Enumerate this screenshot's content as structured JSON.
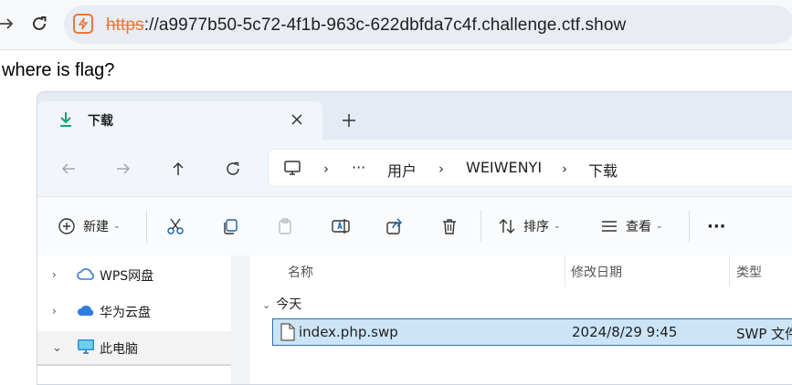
{
  "browser": {
    "url_scheme": "https",
    "url_rest": "://a9977b50-5c72-4f1b-963c-622dbfda7c4f.challenge.ctf.show"
  },
  "page": {
    "text": "where is flag?"
  },
  "explorer": {
    "tab": {
      "title": "下载"
    },
    "breadcrumb": {
      "more": "···",
      "items": [
        "用户",
        "WEIWENYI",
        "下载"
      ]
    },
    "commands": {
      "new": "新建",
      "sort": "排序",
      "view": "查看",
      "more": "···"
    },
    "nav_items": [
      {
        "label": "WPS网盘",
        "icon": "wps-cloud-icon"
      },
      {
        "label": "华为云盘",
        "icon": "huawei-cloud-icon"
      },
      {
        "label": "此电脑",
        "icon": "computer-icon"
      }
    ],
    "columns": {
      "name": "名称",
      "modified": "修改日期",
      "type": "类型"
    },
    "group": {
      "label": "今天"
    },
    "file": {
      "name": "index.php.swp",
      "modified": "2024/8/29 9:45",
      "type": "SWP 文件"
    }
  },
  "colors": {
    "accent": "#2b6fb0",
    "selection": "#cce4f7",
    "warning": "#e8763a",
    "download": "#1aa37a"
  }
}
